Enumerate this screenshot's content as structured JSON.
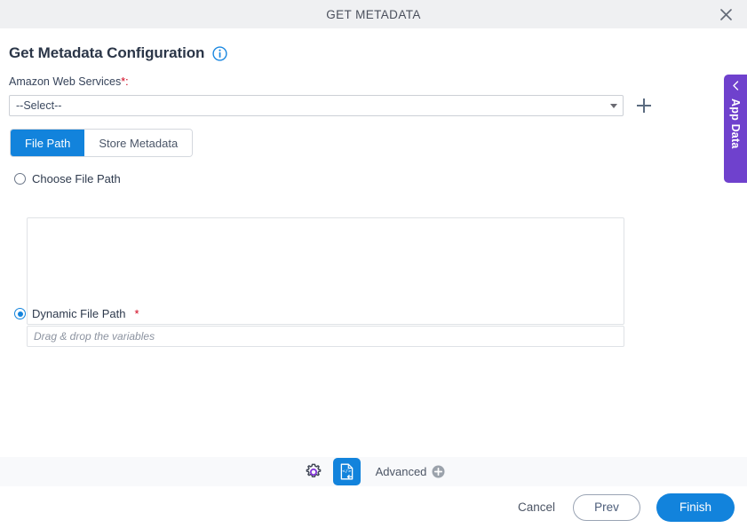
{
  "window": {
    "title": "GET METADATA",
    "close_icon": "close-icon"
  },
  "page": {
    "title": "Get Metadata Configuration",
    "info_icon": "info-icon"
  },
  "connection": {
    "label": "Amazon Web Services",
    "required_mark": "*:",
    "selected_value": "--Select--",
    "add_icon": "plus-icon"
  },
  "tabs": [
    {
      "label": "File Path",
      "active": true
    },
    {
      "label": "Store Metadata",
      "active": false
    }
  ],
  "file_path": {
    "choose_option_label": "Choose File Path",
    "choose_selected": false,
    "textarea_value": "",
    "dynamic_option_label": "Dynamic File Path",
    "dynamic_required_mark": "*",
    "dynamic_selected": true,
    "dynamic_placeholder": "Drag & drop the variables",
    "dynamic_value": ""
  },
  "side_panel": {
    "label": "App Data",
    "collapse_icon": "chevron-left-icon"
  },
  "toolbar": {
    "settings_icon": "gear-icon",
    "code_icon": "code-document-icon",
    "advanced_label": "Advanced",
    "advanced_add_icon": "circle-plus-icon"
  },
  "footer": {
    "cancel_label": "Cancel",
    "prev_label": "Prev",
    "finish_label": "Finish"
  },
  "colors": {
    "accent_blue": "#1283dc",
    "purple": "#6f41cd",
    "required_red": "#d0021b",
    "header_gray": "#eff0f2",
    "toolbar_gray": "#f8f9fb"
  }
}
